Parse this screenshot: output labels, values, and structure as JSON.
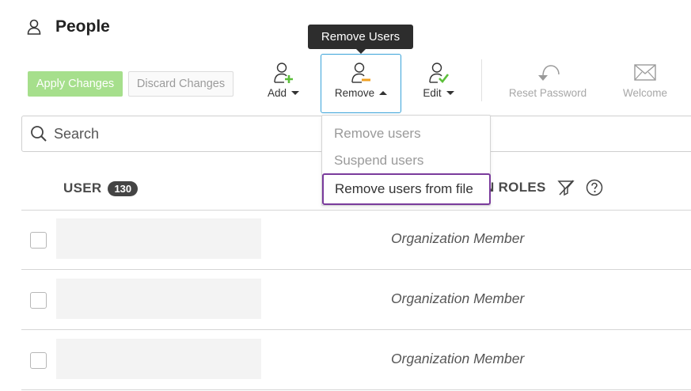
{
  "header": {
    "title": "People"
  },
  "actions": {
    "apply_label": "Apply Changes",
    "discard_label": "Discard Changes"
  },
  "toolbar": {
    "add_label": "Add",
    "remove_label": "Remove",
    "edit_label": "Edit",
    "reset_label": "Reset Password",
    "welcome_label": "Welcome",
    "tooltip": "Remove Users"
  },
  "remove_menu": {
    "items": [
      {
        "label": "Remove users"
      },
      {
        "label": "Suspend users"
      },
      {
        "label": "Remove users from file"
      }
    ]
  },
  "search": {
    "placeholder": "Search"
  },
  "table": {
    "col_user": "USER",
    "user_count": "130",
    "col_roles": "N ROLES",
    "rows": [
      {
        "role": "Organization Member"
      },
      {
        "role": "Organization Member"
      },
      {
        "role": "Organization Member"
      }
    ]
  },
  "colors": {
    "accent": "#3aa3d9",
    "apply": "#a6df8c",
    "highlight": "#7a3b9c",
    "add": "#5cbf3a",
    "remove": "#f0a020",
    "edit": "#5cbf3a"
  },
  "icons": [
    "person-icon",
    "add-user-icon",
    "remove-user-icon",
    "edit-user-icon",
    "reset-password-icon",
    "welcome-envelope-icon",
    "search-icon",
    "filter-off-icon",
    "help-icon"
  ]
}
